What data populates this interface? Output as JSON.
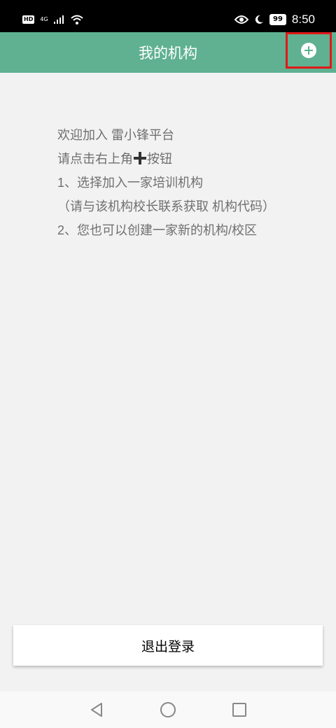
{
  "status_bar": {
    "hd": "HD",
    "network": "4G",
    "battery": "99",
    "time": "8:50"
  },
  "header": {
    "title": "我的机构",
    "add_icon": "plus-circle-icon"
  },
  "content": {
    "lines": [
      "欢迎加入 雷小锋平台",
      "请点击右上角",
      "按钮",
      "1、选择加入一家培训机构",
      "（请与该机构校长联系获取 机构代码）",
      "2、您也可以创建一家新的机构/校区"
    ]
  },
  "footer": {
    "logout_label": "退出登录"
  },
  "colors": {
    "accent": "#5fb191",
    "highlight": "#e01818"
  }
}
